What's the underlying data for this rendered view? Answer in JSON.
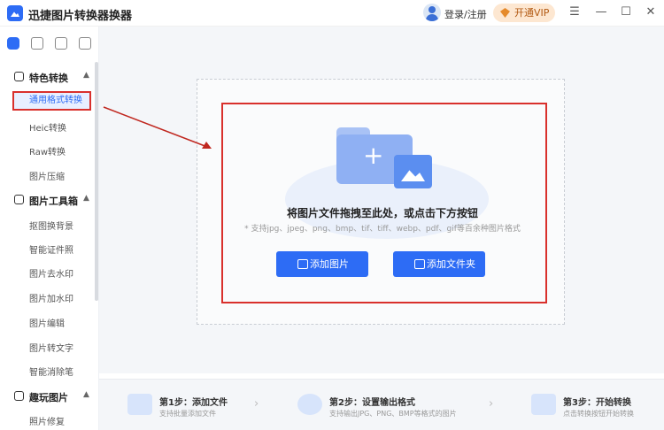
{
  "app": {
    "title": "迅捷图片转换器换器"
  },
  "header": {
    "login": "登录/注册",
    "vip": "开通VIP",
    "menu": "☰",
    "min": "—",
    "max": "☐",
    "close": "✕"
  },
  "sidebar": {
    "sections": [
      {
        "label": "特色转换",
        "caret": "▲"
      },
      {
        "label": "图片工具箱",
        "caret": "▲"
      },
      {
        "label": "趣玩图片",
        "caret": "▲"
      }
    ],
    "items": [
      "通用格式转换",
      "Heic转换",
      "Raw转换",
      "图片压缩",
      "抠图换背景",
      "智能证件照",
      "图片去水印",
      "图片加水印",
      "图片编辑",
      "图片转文字",
      "智能消除笔",
      "照片修复"
    ]
  },
  "dropzone": {
    "title": "将图片文件拖拽至此处，或点击下方按钮",
    "subtitle": "* 支持jpg、jpeg、png、bmp、tif、tiff、webp、pdf、gif等百余种图片格式",
    "add_image": "添加图片",
    "add_folder": "添加文件夹"
  },
  "steps": [
    {
      "title": "第1步：添加文件",
      "desc": "支持批量添加文件"
    },
    {
      "title": "第2步：设置输出格式",
      "desc": "支持输出JPG、PNG、BMP等格式的图片"
    },
    {
      "title": "第3步：开始转换",
      "desc": "点击转换按钮开始转换"
    }
  ]
}
